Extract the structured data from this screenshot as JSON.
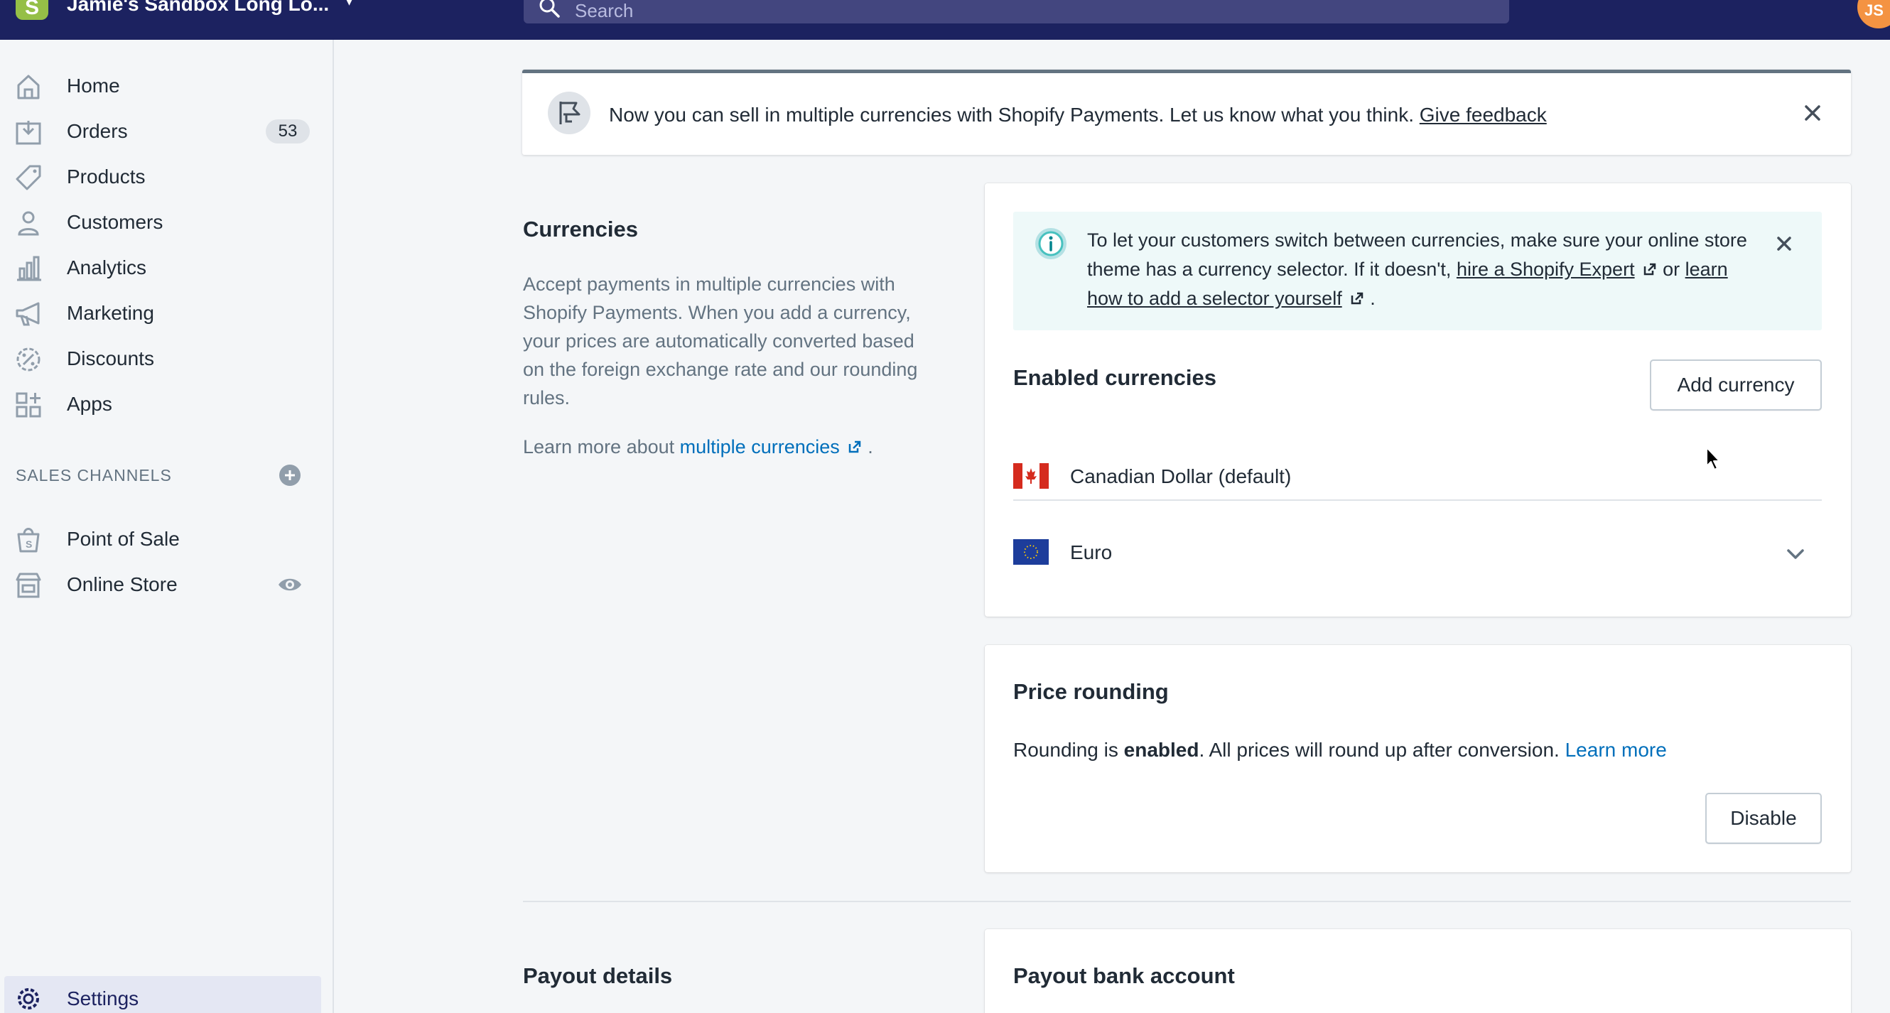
{
  "topbar": {
    "logo_letter": "S",
    "store_name": "Jamie's Sandbox Long Lo...",
    "search_placeholder": "Search",
    "avatar_initials": "JS"
  },
  "sidebar": {
    "items": [
      {
        "label": "Home",
        "icon": "home-icon"
      },
      {
        "label": "Orders",
        "icon": "orders-icon",
        "badge": "53"
      },
      {
        "label": "Products",
        "icon": "tag-icon"
      },
      {
        "label": "Customers",
        "icon": "person-icon"
      },
      {
        "label": "Analytics",
        "icon": "bar-chart-icon"
      },
      {
        "label": "Marketing",
        "icon": "megaphone-icon"
      },
      {
        "label": "Discounts",
        "icon": "discount-icon"
      },
      {
        "label": "Apps",
        "icon": "apps-icon"
      }
    ],
    "sales_channels_heading": "SALES CHANNELS",
    "channels": [
      {
        "label": "Point of Sale",
        "icon": "shopping-bag-icon"
      },
      {
        "label": "Online Store",
        "icon": "store-icon"
      }
    ],
    "settings_label": "Settings"
  },
  "banner": {
    "text": "Now you can sell in multiple currencies with Shopify Payments. Let us know what you think.",
    "link": "Give feedback"
  },
  "currencies_section": {
    "title": "Currencies",
    "description": "Accept payments in multiple currencies with Shopify Payments. When you add a currency, your prices are automatically converted based on the foreign exchange rate and our rounding rules.",
    "learn_more_prefix": "Learn more about",
    "learn_more_link": "multiple currencies",
    "learn_more_suffix": "."
  },
  "info_box": {
    "text_1": "To let your customers switch between currencies, make sure your online store theme has a currency selector. If it doesn't,",
    "link_1": "hire a Shopify Expert",
    "text_2": "or",
    "link_2": "learn how to add a selector yourself",
    "text_3": "."
  },
  "enabled_currencies": {
    "title": "Enabled currencies",
    "add_button": "Add currency",
    "list": [
      {
        "name": "Canadian Dollar (default)",
        "flag": "canada-flag"
      },
      {
        "name": "Euro",
        "flag": "eu-flag"
      }
    ]
  },
  "price_rounding": {
    "title": "Price rounding",
    "text_prefix": "Rounding is",
    "text_bold": "enabled",
    "text_suffix": ". All prices will round up after conversion.",
    "learn_more": "Learn more",
    "disable_button": "Disable"
  },
  "payout": {
    "section_title": "Payout details",
    "card_title": "Payout bank account"
  },
  "colors": {
    "topbar": "#1c2260",
    "link": "#006fbb",
    "info_bg": "#eef9f9",
    "logo_green": "#95bf47"
  }
}
